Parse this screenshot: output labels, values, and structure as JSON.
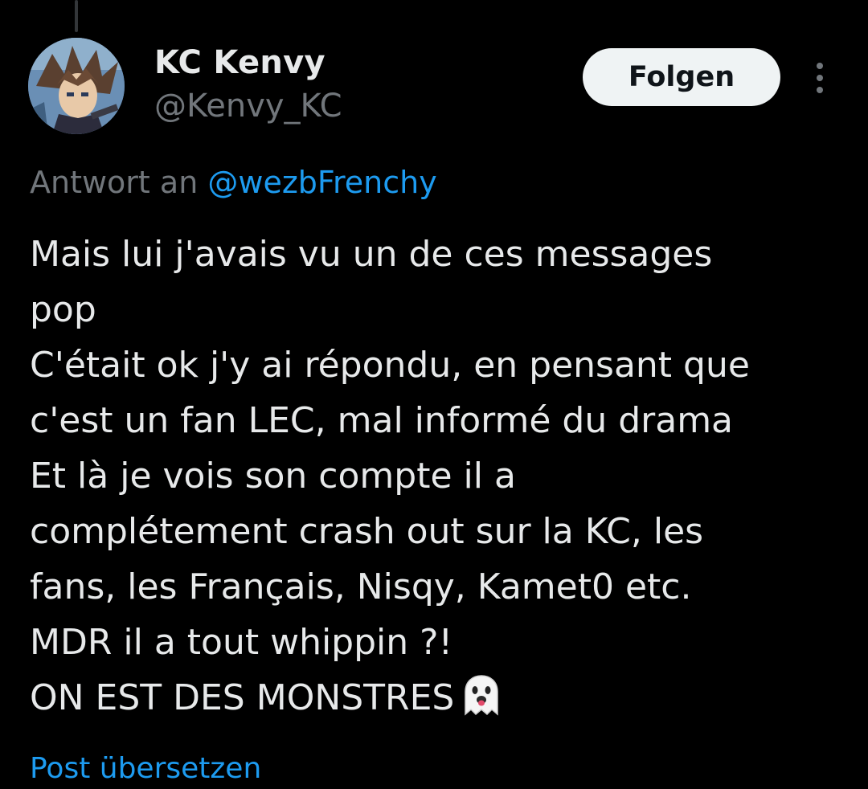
{
  "author": {
    "display_name": "KC Kenvy",
    "handle": "@Kenvy_KC",
    "avatar_icon": "anime-avatar"
  },
  "actions": {
    "follow_label": "Folgen",
    "more_icon": "more-vertical-icon"
  },
  "reply_context": {
    "prefix": "Antwort an",
    "mention": "@wezbFrenchy"
  },
  "tweet": {
    "lines": [
      "Mais lui j'avais vu un de ces messages",
      "pop",
      "C'était ok j'y ai répondu, en pensant que",
      "c'est un fan LEC, mal informé du drama",
      "Et là je vois son compte il a",
      "complétement crash out sur la KC, les",
      "fans, les Français, Nisqy, Kamet0 etc.",
      "MDR il a tout whippin ?!",
      "ON EST DES MONSTRES"
    ],
    "emoji": "ghost-emoji"
  },
  "translate_label": "Post übersetzen",
  "colors": {
    "background": "#000000",
    "primary_text": "#e7e9ea",
    "secondary_text": "#71767b",
    "link": "#1d9bf0",
    "button_bg": "#eff3f4",
    "button_text": "#0f1419"
  }
}
